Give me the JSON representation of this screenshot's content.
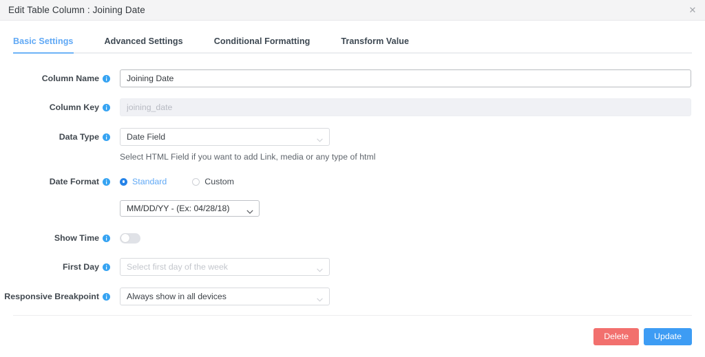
{
  "header": {
    "title": "Edit Table Column : Joining Date",
    "close_label": "✕"
  },
  "tabs": [
    {
      "label": "Basic Settings",
      "active": true
    },
    {
      "label": "Advanced Settings",
      "active": false
    },
    {
      "label": "Conditional Formatting",
      "active": false
    },
    {
      "label": "Transform Value",
      "active": false
    }
  ],
  "fields": {
    "column_name": {
      "label": "Column Name",
      "value": "Joining Date"
    },
    "column_key": {
      "label": "Column Key",
      "placeholder": "joining_date",
      "value": ""
    },
    "data_type": {
      "label": "Data Type",
      "value": "Date Field",
      "helper": "Select HTML Field if you want to add Link, media or any type of html"
    },
    "date_format": {
      "label": "Date Format",
      "options": [
        {
          "label": "Standard",
          "selected": true
        },
        {
          "label": "Custom",
          "selected": false
        }
      ],
      "format_value": "MM/DD/YY - (Ex: 04/28/18)"
    },
    "show_time": {
      "label": "Show Time",
      "state": "off"
    },
    "first_day": {
      "label": "First Day",
      "placeholder": "Select first day of the week",
      "value": ""
    },
    "responsive_breakpoint": {
      "label": "Responsive Breakpoint",
      "value": "Always show in all devices"
    }
  },
  "footer": {
    "delete_label": "Delete",
    "update_label": "Update"
  },
  "colors": {
    "accent_blue": "#3d9cf4",
    "danger_red": "#f2706e",
    "info_blue": "#35a3f2",
    "tab_active": "#5fa8f5"
  }
}
